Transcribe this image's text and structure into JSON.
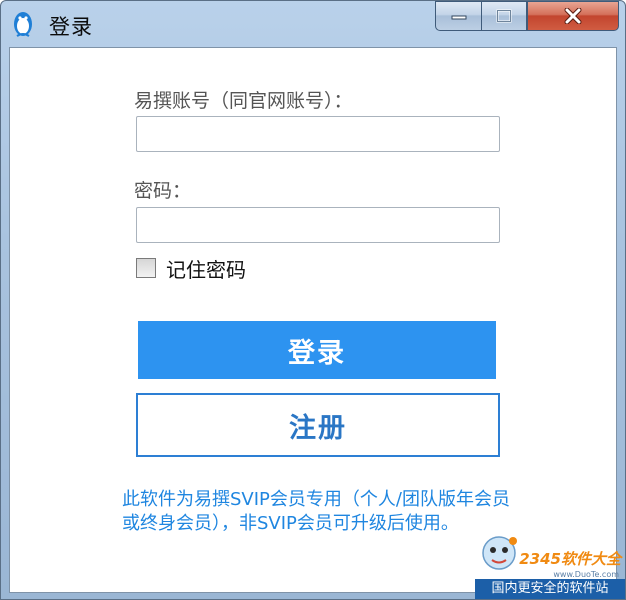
{
  "window": {
    "title": "登录",
    "accent_color": "#2d93f0",
    "close_color": "#c2452e"
  },
  "icons": {
    "app": "penguin-logo-icon",
    "minimize": "minimize-icon",
    "maximize": "maximize-icon",
    "close": "close-icon",
    "checkbox": "checkbox-unchecked-icon"
  },
  "form": {
    "account_label": "易撰账号（同官网账号）：",
    "account_value": "",
    "password_label": "密码：",
    "password_value": "",
    "remember_label": "记住密码",
    "remember_checked": false
  },
  "buttons": {
    "login": "登录",
    "register": "注册"
  },
  "notice": "此软件为易撰SVIP会员专用（个人/团队版年会员或终身会员），非SVIP会员可升级后使用。",
  "watermark": {
    "logo": "2345软件大全",
    "url": "www.DuoTe.com",
    "slogan": "国内更安全的软件站"
  }
}
